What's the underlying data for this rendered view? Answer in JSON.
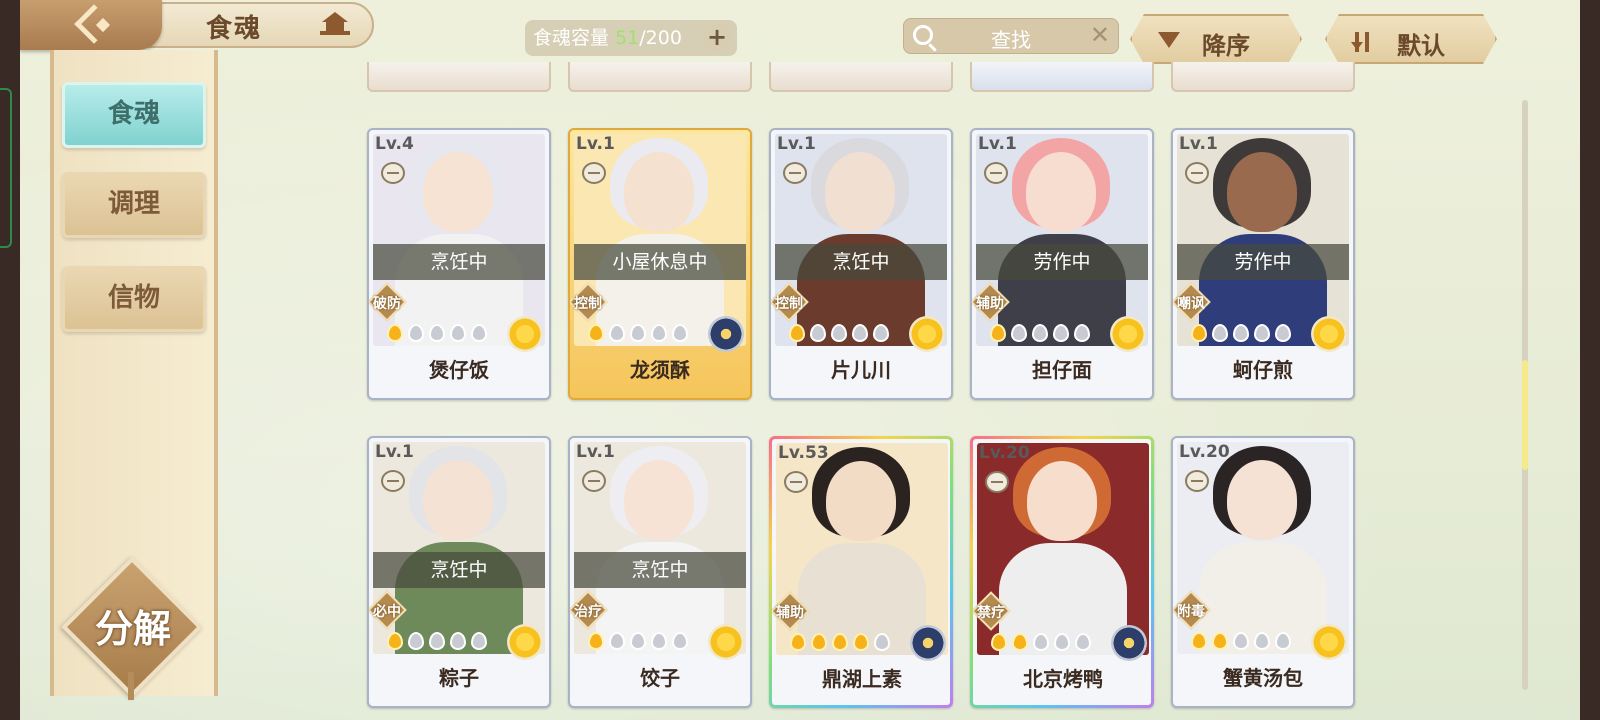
{
  "header": {
    "title": "食魂",
    "capacity": {
      "label": "食魂容量",
      "current": "51",
      "max": "/200"
    },
    "search_placeholder": "查找",
    "sort_desc_label": "降序",
    "sort_default_label": "默认"
  },
  "sidebar": {
    "tabs": [
      {
        "label": "食魂",
        "active": true
      },
      {
        "label": "调理",
        "active": false
      },
      {
        "label": "信物",
        "active": false
      }
    ],
    "decompose_label": "分解"
  },
  "cards": [
    {
      "level": "Lv.4",
      "status": "烹饪中",
      "role": "破防",
      "flames_on": 1,
      "badge": "yellow",
      "name": "煲仔饭",
      "frame": "silver",
      "colors": {
        "sky": "#e9e6f0",
        "hair": "#e7e7ef",
        "head": "#f7e3d3",
        "body": "#f2f2f2"
      }
    },
    {
      "level": "Lv.1",
      "status": "小屋休息中",
      "role": "控制",
      "flames_on": 1,
      "badge": "navy",
      "name": "龙须酥",
      "frame": "gold",
      "colors": {
        "sky": "#fbe7b2",
        "hair": "#eaeaf0",
        "head": "#f5e1d0",
        "body": "#f4f1ea"
      }
    },
    {
      "level": "Lv.1",
      "status": "烹饪中",
      "role": "控制",
      "flames_on": 1,
      "badge": "yellow",
      "name": "片儿川",
      "frame": "silver",
      "colors": {
        "sky": "#dfe3ee",
        "hair": "#d9d9de",
        "head": "#f1dfd2",
        "body": "#6b3b2e"
      }
    },
    {
      "level": "Lv.1",
      "status": "劳作中",
      "role": "辅助",
      "flames_on": 1,
      "badge": "yellow",
      "name": "担仔面",
      "frame": "silver",
      "colors": {
        "sky": "#dfe3ee",
        "hair": "#f3a5a5",
        "head": "#f6ddd0",
        "body": "#3f3f4a"
      }
    },
    {
      "level": "Lv.1",
      "status": "劳作中",
      "role": "嘲讽",
      "flames_on": 1,
      "badge": "yellow",
      "name": "蚵仔煎",
      "frame": "silver",
      "colors": {
        "sky": "#e6e2d6",
        "hair": "#3f3a3a",
        "head": "#9a6a4e",
        "body": "#2f3d7a"
      }
    },
    {
      "level": "Lv.1",
      "status": "烹饪中",
      "role": "必中",
      "flames_on": 1,
      "badge": "yellow",
      "name": "粽子",
      "frame": "silver",
      "colors": {
        "sky": "#ece8dd",
        "hair": "#e2e4e8",
        "head": "#f4e2d5",
        "body": "#6f8a5a"
      }
    },
    {
      "level": "Lv.1",
      "status": "烹饪中",
      "role": "治疗",
      "flames_on": 1,
      "badge": "yellow",
      "name": "饺子",
      "frame": "silver",
      "colors": {
        "sky": "#ece8dd",
        "hair": "#eeeef2",
        "head": "#f6e3d6",
        "body": "#f4f4f4"
      }
    },
    {
      "level": "Lv.53",
      "status": "",
      "role": "辅助",
      "flames_on": 4,
      "badge": "navy",
      "name": "鼎湖上素",
      "frame": "rainbow",
      "colors": {
        "sky": "#f5e6c8",
        "hair": "#2a2320",
        "head": "#f3dcc6",
        "body": "#e8e0d2"
      }
    },
    {
      "level": "Lv.20",
      "status": "",
      "role": "禁疗",
      "flames_on": 2,
      "badge": "navy",
      "name": "北京烤鸭",
      "frame": "rainbow",
      "colors": {
        "sky": "#8a2a2a",
        "hair": "#d06a35",
        "head": "#f6ddcc",
        "body": "#eeeeee"
      }
    },
    {
      "level": "Lv.20",
      "status": "",
      "role": "附毒",
      "flames_on": 2,
      "badge": "yellow",
      "name": "蟹黄汤包",
      "frame": "silver",
      "colors": {
        "sky": "#ecedf2",
        "hair": "#2a2424",
        "head": "#f6e2d4",
        "body": "#f2efe8"
      }
    }
  ]
}
